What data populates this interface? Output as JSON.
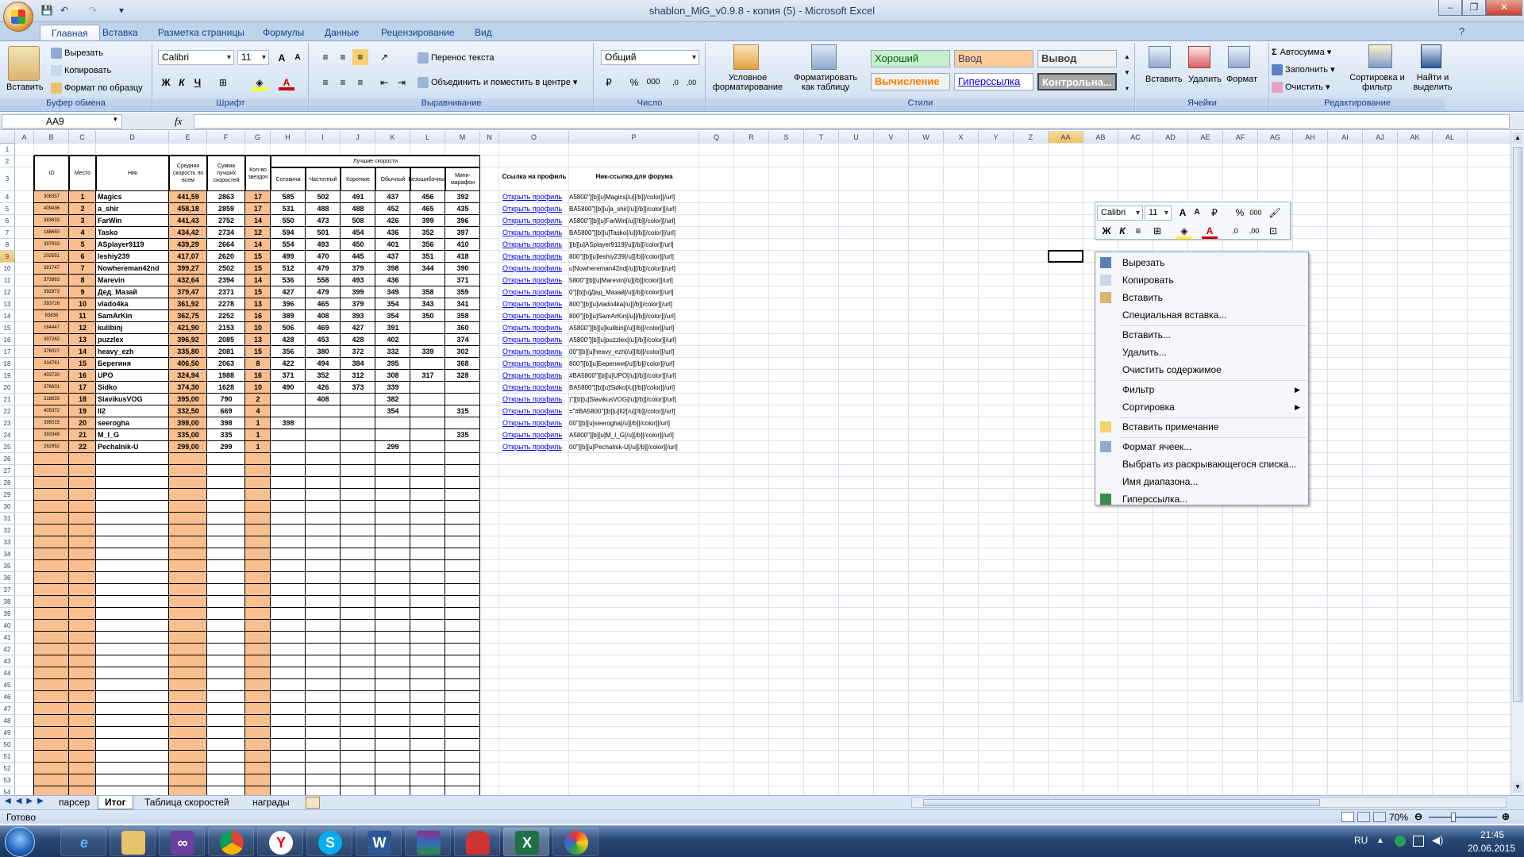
{
  "window": {
    "title": "shablon_MiG_v0.9.8 - копия (5) - Microsoft Excel",
    "qat_undo": "↶",
    "qat_redo": "↷",
    "controls": {
      "minimize": "–",
      "maximize": "❐",
      "close": "✕"
    }
  },
  "tabs": [
    "Главная",
    "Вставка",
    "Разметка страницы",
    "Формулы",
    "Данные",
    "Рецензирование",
    "Вид"
  ],
  "ribbon": {
    "clipboard": {
      "paste": "Вставить",
      "cut": "Вырезать",
      "copy": "Копировать",
      "format_painter": "Формат по образцу",
      "label": "Буфер обмена"
    },
    "font": {
      "name": "Calibri",
      "size": "11",
      "bold": "Ж",
      "italic": "К",
      "underline": "Ч",
      "label": "Шрифт"
    },
    "alignment": {
      "wrap": "Перенос текста",
      "merge": "Объединить и поместить в центре",
      "label": "Выравнивание"
    },
    "number": {
      "format": "Общий",
      "percent": "%",
      "thousands": "000",
      "label": "Число"
    },
    "styles": {
      "conditional": "Условное форматирование",
      "as_table": "Форматировать как таблицу",
      "good": "Хороший",
      "input": "Ввод",
      "output": "Вывод",
      "calc": "Вычисление",
      "hyperlink": "Гиперссылка",
      "check": "Контрольна...",
      "label": "Стили"
    },
    "cells": {
      "insert": "Вставить",
      "delete": "Удалить",
      "format": "Формат",
      "label": "Ячейки"
    },
    "editing": {
      "autosum": "Автосумма",
      "fill": "Заполнить",
      "clear": "Очистить",
      "sort": "Сортировка и фильтр",
      "find": "Найти и выделить",
      "label": "Редактирование"
    }
  },
  "formula_bar": {
    "name_box": "AA9",
    "fx": "fx",
    "formula": ""
  },
  "columns": [
    "A",
    "B",
    "C",
    "D",
    "E",
    "F",
    "G",
    "H",
    "I",
    "J",
    "K",
    "L",
    "M",
    "N",
    "O",
    "P",
    "Q",
    "R",
    "S",
    "T",
    "U",
    "V",
    "W",
    "X",
    "Y",
    "Z",
    "AA",
    "AB",
    "AC",
    "AD",
    "AE",
    "AF",
    "AG",
    "AH",
    "AI",
    "AJ",
    "AK",
    "AL"
  ],
  "table_headers": {
    "id": "ID",
    "place": "Место",
    "nick": "Ник",
    "avg": "Средняя скорость по всем",
    "sum": "Сумма лучших скоростей",
    "stars": "Кол-во звездоч",
    "best": "Лучшие скорости",
    "modes": [
      "Сотовича",
      "Частотный",
      "Короткие",
      "Обычный",
      "Безошибочный",
      "Мини-марафон"
    ],
    "link_col": "Ссылка на профиль",
    "forum_col": "Ник-ссылка для форума"
  },
  "rows": [
    {
      "id": "308357",
      "place": "1",
      "nick": "Magics",
      "avg": "441,59",
      "sum": "2863",
      "stars": "17",
      "s": [
        "585",
        "502",
        "491",
        "437",
        "456",
        "392"
      ],
      "link": "Открыть профиль",
      "forum": "A5800\"][b][u]Magics[/u][/b][/color][/url]"
    },
    {
      "id": "409436",
      "place": "2",
      "nick": "a_shir",
      "avg": "458,18",
      "sum": "2859",
      "stars": "17",
      "s": [
        "531",
        "488",
        "488",
        "452",
        "465",
        "435"
      ],
      "link": "Открыть профиль",
      "forum": "BA5800\"][b][u]a_shir[/u][/b][/color][/url]"
    },
    {
      "id": "383633",
      "place": "3",
      "nick": "FarWin",
      "avg": "441,43",
      "sum": "2752",
      "stars": "14",
      "s": [
        "550",
        "473",
        "508",
        "426",
        "399",
        "396"
      ],
      "link": "Открыть профиль",
      "forum": "A5800\"][b][u]FarWin[/u][/b][/color][/url]"
    },
    {
      "id": "188650",
      "place": "4",
      "nick": "Tasko",
      "avg": "434,42",
      "sum": "2734",
      "stars": "12",
      "s": [
        "594",
        "501",
        "454",
        "436",
        "352",
        "397"
      ],
      "link": "Открыть профиль",
      "forum": "BA5800\"][b][u]Tasko[/u][/b][/color][/url]"
    },
    {
      "id": "397933",
      "place": "5",
      "nick": "ASplayer9119",
      "avg": "439,29",
      "sum": "2664",
      "stars": "14",
      "s": [
        "554",
        "493",
        "450",
        "401",
        "356",
        "410"
      ],
      "link": "Открыть профиль",
      "forum": "][b][u]ASplayer9119[/u][/b][/color][/url]"
    },
    {
      "id": "202551",
      "place": "6",
      "nick": "leshiy239",
      "avg": "417,07",
      "sum": "2620",
      "stars": "15",
      "s": [
        "499",
        "470",
        "445",
        "437",
        "351",
        "418"
      ],
      "link": "Открыть профиль",
      "forum": "800\"][b][u]leshiy239[/u][/b][/color][/url]"
    },
    {
      "id": "381747",
      "place": "7",
      "nick": "Nowhereman42nd",
      "avg": "399,27",
      "sum": "2502",
      "stars": "15",
      "s": [
        "512",
        "479",
        "379",
        "398",
        "344",
        "390"
      ],
      "link": "Открыть профиль",
      "forum": "u]Nowhereman42nd[/u][/b][/color][/url]"
    },
    {
      "id": "373863",
      "place": "8",
      "nick": "Marevin",
      "avg": "432,64",
      "sum": "2394",
      "stars": "14",
      "s": [
        "536",
        "558",
        "493",
        "436",
        "",
        "371"
      ],
      "link": "Открыть профиль",
      "forum": "5800\"][b][u]Marevin[/u][/b][/color][/url]"
    },
    {
      "id": "392973",
      "place": "9",
      "nick": "Дед_Мазай",
      "avg": "379,47",
      "sum": "2371",
      "stars": "15",
      "s": [
        "427",
        "479",
        "399",
        "349",
        "358",
        "359"
      ],
      "link": "Открыть профиль",
      "forum": "0\"][b][u]Дед_Мазай[/u][/b][/color][/url]"
    },
    {
      "id": "393716",
      "place": "10",
      "nick": "vlado4ka",
      "avg": "361,92",
      "sum": "2278",
      "stars": "13",
      "s": [
        "396",
        "465",
        "379",
        "354",
        "343",
        "341"
      ],
      "link": "Открыть профиль",
      "forum": "800\"][b][u]vlado4ka[/u][/b][/color][/url]"
    },
    {
      "id": "83836",
      "place": "11",
      "nick": "SamArKin",
      "avg": "362,75",
      "sum": "2252",
      "stars": "16",
      "s": [
        "389",
        "408",
        "393",
        "354",
        "350",
        "358"
      ],
      "link": "Открыть профиль",
      "forum": "800\"][b][u]SamArKin[/u][/b][/color][/url]"
    },
    {
      "id": "164447",
      "place": "12",
      "nick": "kulibinj",
      "avg": "421,90",
      "sum": "2153",
      "stars": "10",
      "s": [
        "506",
        "469",
        "427",
        "391",
        "",
        "360"
      ],
      "link": "Открыть профиль",
      "forum": "A5800\"][b][u]kulibinj[/u][/b][/color][/url]"
    },
    {
      "id": "397262",
      "place": "13",
      "nick": "puzzlex",
      "avg": "396,92",
      "sum": "2085",
      "stars": "13",
      "s": [
        "428",
        "453",
        "428",
        "402",
        "",
        "374"
      ],
      "link": "Открыть профиль",
      "forum": "A5800\"][b][u]puzzlex[/u][/b][/color][/url]"
    },
    {
      "id": "376027",
      "place": "14",
      "nick": "heavy_ezh",
      "avg": "335,80",
      "sum": "2081",
      "stars": "15",
      "s": [
        "356",
        "380",
        "372",
        "332",
        "339",
        "302"
      ],
      "link": "Открыть профиль",
      "forum": "00\"][b][u]heavy_ezh[/u][/b][/color][/url]"
    },
    {
      "id": "314761",
      "place": "15",
      "nick": "Берегиня",
      "avg": "406,50",
      "sum": "2063",
      "stars": "8",
      "s": [
        "422",
        "494",
        "384",
        "395",
        "",
        "368"
      ],
      "link": "Открыть профиль",
      "forum": "800\"][b][u]Берегиня[/u][/b][/color][/url]"
    },
    {
      "id": "403730",
      "place": "16",
      "nick": "UPO",
      "avg": "324,94",
      "sum": "1988",
      "stars": "16",
      "s": [
        "371",
        "352",
        "312",
        "308",
        "317",
        "328"
      ],
      "link": "Открыть профиль",
      "forum": "#BA5800\"][b][u]UPO[/u][/b][/color][/url]"
    },
    {
      "id": "376601",
      "place": "17",
      "nick": "Sidko",
      "avg": "374,30",
      "sum": "1628",
      "stars": "10",
      "s": [
        "490",
        "426",
        "373",
        "339",
        "",
        ""
      ],
      "link": "Открыть профиль",
      "forum": "BA5800\"][b][u]Sidko[/u][/b][/color][/url]"
    },
    {
      "id": "318633",
      "place": "18",
      "nick": "SlavikusVOG",
      "avg": "395,00",
      "sum": "790",
      "stars": "2",
      "s": [
        "",
        "408",
        "",
        "382",
        "",
        ""
      ],
      "link": "Открыть профиль",
      "forum": ")\"][b][u]SlavikusVOG[/u][/b][/color][/url]"
    },
    {
      "id": "405372",
      "place": "19",
      "nick": "Il2",
      "avg": "332,50",
      "sum": "669",
      "stars": "4",
      "s": [
        "",
        "",
        "",
        "354",
        "",
        "315"
      ],
      "link": "Открыть профиль",
      "forum": "=\"#BA5800\"][b][u]Il2[/u][/b][/color][/url]"
    },
    {
      "id": "395015",
      "place": "20",
      "nick": "seerogha",
      "avg": "398,00",
      "sum": "398",
      "stars": "1",
      "s": [
        "398",
        "",
        "",
        "",
        "",
        ""
      ],
      "link": "Открыть профиль",
      "forum": "00\"][b][u]seerogha[/u][/b][/color][/url]"
    },
    {
      "id": "393348",
      "place": "21",
      "nick": "M_I_G",
      "avg": "335,00",
      "sum": "335",
      "stars": "1",
      "s": [
        "",
        "",
        "",
        "",
        "",
        "335"
      ],
      "link": "Открыть профиль",
      "forum": "A5800\"][b][u]M_I_G[/u][/b][/color][/url]"
    },
    {
      "id": "262952",
      "place": "22",
      "nick": "Pechalnik-U",
      "avg": "299,00",
      "sum": "299",
      "stars": "1",
      "s": [
        "",
        "",
        "",
        "299",
        "",
        ""
      ],
      "link": "Открыть профиль",
      "forum": "00\"][b][u]Pechalnik-U[/u][/b][/color][/url]"
    }
  ],
  "mini_toolbar": {
    "font": "Calibri",
    "size": "11",
    "percent": "%",
    "thousands": "000",
    "bold": "Ж",
    "italic": "К"
  },
  "context_menu": [
    {
      "label": "Вырезать",
      "icon": "scissors-icon"
    },
    {
      "label": "Копировать",
      "icon": "copy-icon"
    },
    {
      "label": "Вставить",
      "icon": "paste-icon"
    },
    {
      "label": "Специальная вставка...",
      "icon": ""
    },
    {
      "label": "Вставить...",
      "icon": "",
      "sep": true
    },
    {
      "label": "Удалить...",
      "icon": ""
    },
    {
      "label": "Очистить содержимое",
      "icon": ""
    },
    {
      "label": "Фильтр",
      "icon": "",
      "sep": true,
      "sub": true
    },
    {
      "label": "Сортировка",
      "icon": "",
      "sub": true
    },
    {
      "label": "Вставить примечание",
      "icon": "comment-icon",
      "sep": true
    },
    {
      "label": "Формат ячеек...",
      "icon": "format-cells-icon",
      "sep": true
    },
    {
      "label": "Выбрать из раскрывающегося списка...",
      "icon": ""
    },
    {
      "label": "Имя диапазона...",
      "icon": ""
    },
    {
      "label": "Гиперссылка...",
      "icon": "hyperlink-icon"
    }
  ],
  "sheets": [
    "парсер",
    "Итог",
    "Таблица скоростей",
    "награды"
  ],
  "active_sheet": "Итог",
  "status": {
    "ready": "Готово",
    "zoom": "70%"
  },
  "tray": {
    "lang": "RU",
    "time": "21:45",
    "date": "20.06.2015"
  },
  "colors": {
    "peach": "#fabf8f",
    "link": "#0000ee",
    "accent": "#15428b"
  }
}
